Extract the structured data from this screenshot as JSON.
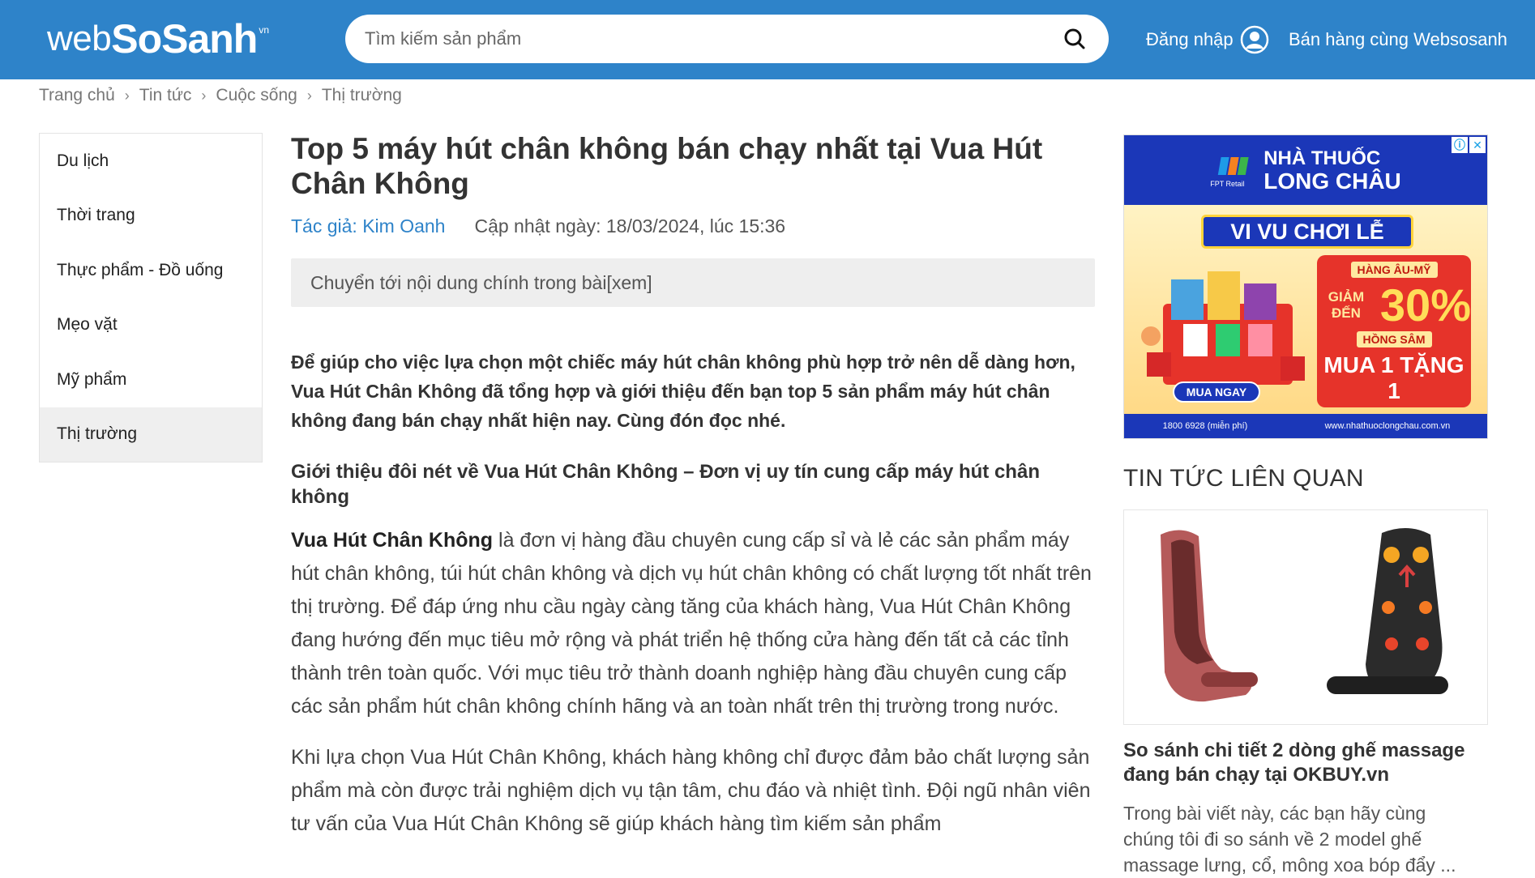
{
  "header": {
    "logo": {
      "web": "web",
      "sosanh": "SoSanh",
      "vn": "vn"
    },
    "search_placeholder": "Tìm kiếm sản phẩm",
    "login_label": "Đăng nhập",
    "sell_label": "Bán hàng cùng Websosanh"
  },
  "breadcrumb": [
    "Trang chủ",
    "Tin tức",
    "Cuộc sống",
    "Thị trường"
  ],
  "sidebar": {
    "items": [
      {
        "label": "Du lịch"
      },
      {
        "label": "Thời trang"
      },
      {
        "label": "Thực phẩm - Đồ uống"
      },
      {
        "label": "Mẹo vặt"
      },
      {
        "label": "Mỹ phẩm"
      },
      {
        "label": "Thị trường"
      }
    ],
    "active": "Thị trường"
  },
  "article": {
    "title": "Top 5 máy hút chân không bán chạy nhất tại Vua Hút Chân Không",
    "author": "Tác giả: Kim Oanh",
    "updated": "Cập nhật ngày: 18/03/2024, lúc 15:36",
    "toc_label": "Chuyển tới nội dung chính trong bài[xem]",
    "intro": "Để giúp cho việc lựa chọn một chiếc máy hút chân không phù hợp trở nên dễ dàng hơn, Vua Hút Chân Không đã tổng hợp và giới thiệu đến bạn top 5 sản phẩm máy hút chân không đang bán chạy nhất hiện nay. Cùng đón đọc nhé.",
    "heading": "Giới thiệu đôi nét về Vua Hút Chân Không – Đơn vị uy tín cung cấp máy hút chân không",
    "para1_bold": "Vua Hút Chân Không",
    "para1_rest": " là đơn vị hàng đầu chuyên cung cấp sỉ và lẻ các sản phẩm máy hút chân không, túi hút chân không và dịch vụ hút chân không có chất lượng tốt nhất trên thị trường. Để đáp ứng nhu cầu ngày càng tăng của khách hàng, Vua Hút Chân Không đang hướng đến mục tiêu mở rộng và phát triển hệ thống cửa hàng đến tất cả các tỉnh thành trên toàn quốc. Với mục tiêu trở thành doanh nghiệp hàng đầu chuyên cung cấp các sản phẩm hút chân không chính hãng và an toàn nhất trên thị trường trong nước.",
    "para2": "Khi lựa chọn Vua Hút Chân Không, khách hàng không chỉ được đảm bảo chất lượng sản phẩm mà còn được trải nghiệm dịch vụ tận tâm, chu đáo và nhiệt tình. Đội ngũ nhân viên tư vấn của Vua Hút Chân Không sẽ giúp khách hàng tìm kiếm sản phẩm"
  },
  "ad": {
    "brand_line1": "NHÀ THUỐC",
    "brand_line2": "LONG CHÂU",
    "brand_sub": "FPT Retail",
    "banner": "VI VU CHƠI LỄ",
    "promo_tag1": "HÀNG ÂU-MỸ",
    "promo_giam": "GIẢM ĐẾN",
    "promo_pct": "30%",
    "promo_tag2": "HỒNG SÂM",
    "promo_gift": "MUA 1 TẶNG 1",
    "buy_label": "MUA NGAY",
    "phone": "1800 6928 (miễn phí)",
    "website": "www.nhathuoclongchau.com.vn",
    "colors": {
      "navy": "#1b37b8",
      "red": "#e6332a",
      "gold": "#ffd43b"
    }
  },
  "related": {
    "section_title": "TIN TỨC LIÊN QUAN",
    "items": [
      {
        "title": "So sánh chi tiết 2 dòng ghế massage đang bán chạy tại OKBUY.vn",
        "desc": "Trong bài viết này, các bạn hãy cùng chúng tôi đi so sánh về 2 model ghế massage lưng, cổ, mông xoa bóp đẩy ..."
      }
    ]
  },
  "colors": {
    "header_bg": "#2e83c9",
    "link": "#2e83c9",
    "sidebar_active": "#efefef"
  }
}
